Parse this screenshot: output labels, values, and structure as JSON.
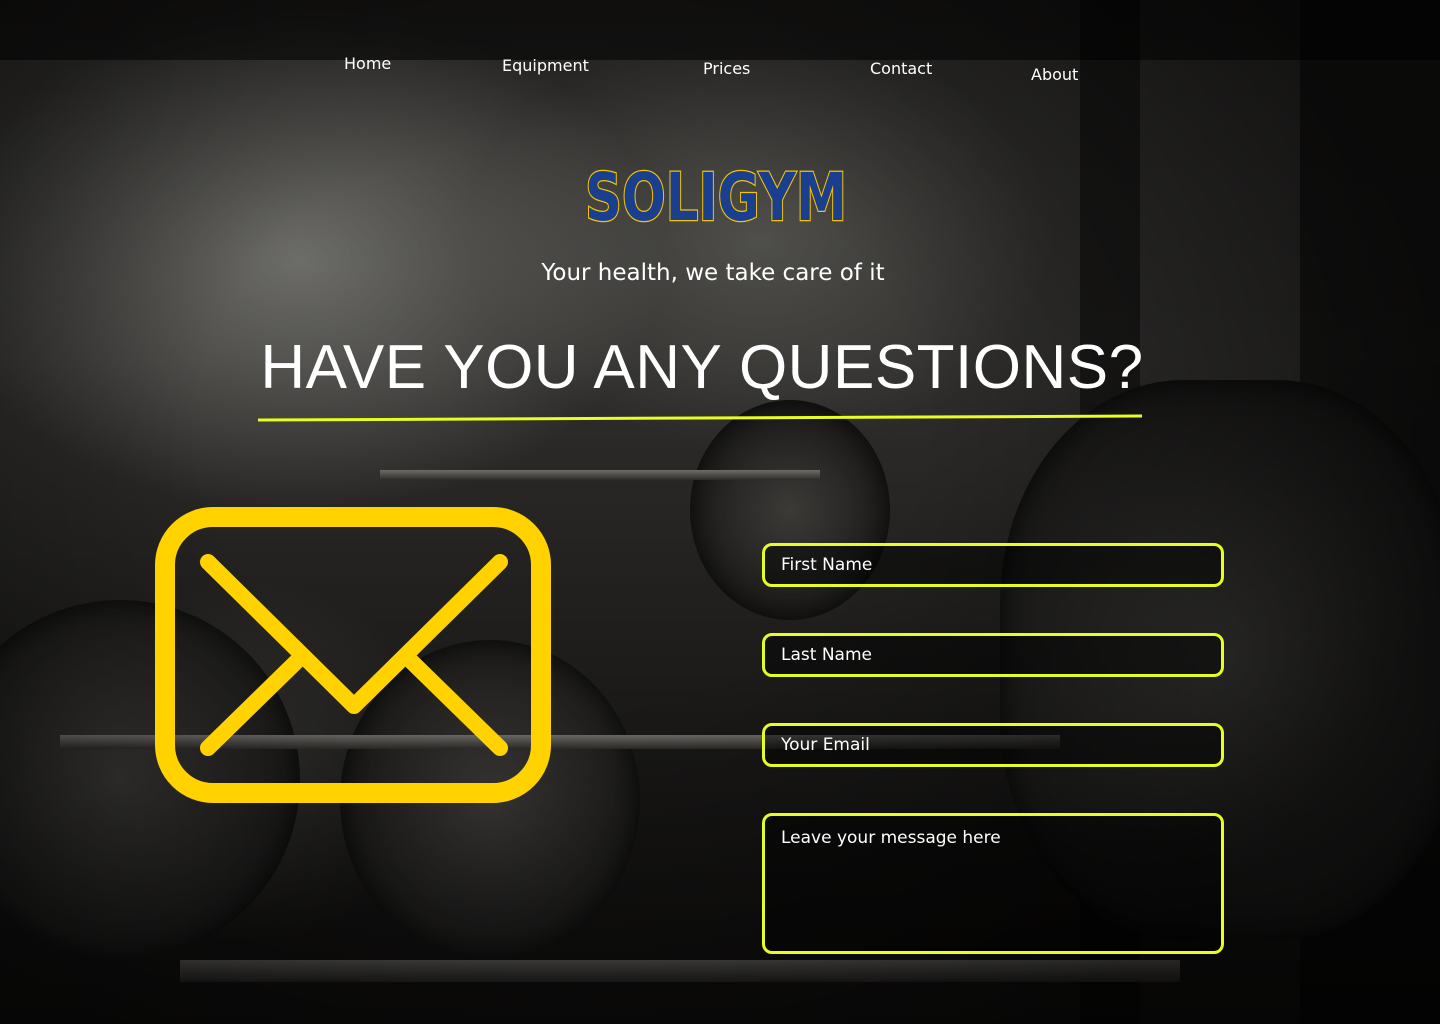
{
  "nav": {
    "items": [
      {
        "label": "Home"
      },
      {
        "label": "Equipment"
      },
      {
        "label": "Prices"
      },
      {
        "label": "Contact"
      },
      {
        "label": "About"
      }
    ]
  },
  "brand": {
    "logo_text": "SOLIGYM",
    "tagline": "Your health, we take care of it"
  },
  "section": {
    "heading": "HAVE YOU ANY QUESTIONS?"
  },
  "form": {
    "first_name_placeholder": "First Name",
    "last_name_placeholder": "Last Name",
    "email_placeholder": "Your Email",
    "message_placeholder": "Leave your message here"
  },
  "colors": {
    "accent": "#e6ff1f",
    "icon_yellow": "#ffd200",
    "logo_blue": "#1b3f8f",
    "logo_outline": "#f5c400"
  },
  "icons": {
    "contact": "mail-icon"
  }
}
